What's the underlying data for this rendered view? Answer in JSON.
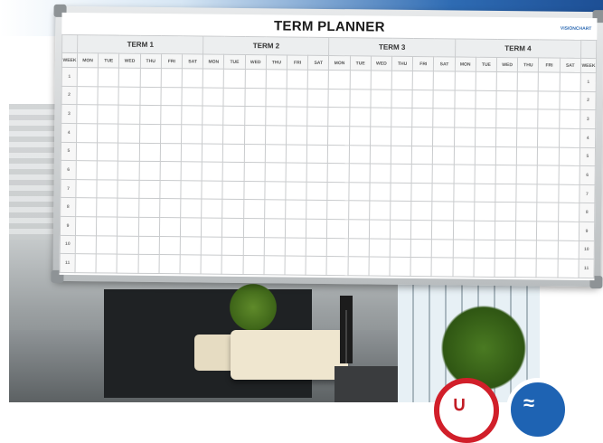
{
  "planner": {
    "title": "TERM PLANNER",
    "brand": "VISIONCHART",
    "week_label": "WEEK",
    "terms": [
      "TERM 1",
      "TERM 2",
      "TERM 3",
      "TERM 4"
    ],
    "days": [
      "MON",
      "TUE",
      "WED",
      "THU",
      "FRI",
      "SAT"
    ],
    "weeks": [
      "1",
      "2",
      "3",
      "4",
      "5",
      "6",
      "7",
      "8",
      "9",
      "10",
      "11"
    ]
  },
  "badges": {
    "magnetic_icon": "magnet-icon",
    "cleaning_icon": "cloth-icon"
  },
  "colors": {
    "banner_blue": "#2e6bb3",
    "badge_red": "#d11f2a",
    "badge_blue": "#1e63b3"
  }
}
